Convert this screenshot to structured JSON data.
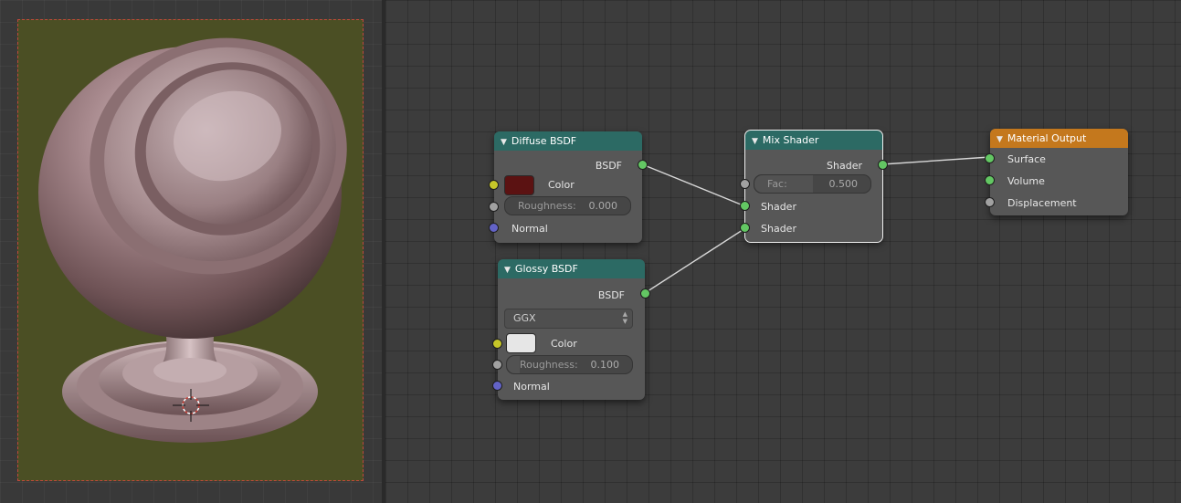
{
  "nodes": {
    "diffuse": {
      "title": "Diffuse BSDF",
      "output": "BSDF",
      "color_label": "Color",
      "color_value": "#5b1212",
      "roughness_label": "Roughness:",
      "roughness_value": "0.000",
      "normal_label": "Normal"
    },
    "glossy": {
      "title": "Glossy BSDF",
      "output": "BSDF",
      "distribution": "GGX",
      "color_label": "Color",
      "color_value": "#e6e6e6",
      "roughness_label": "Roughness:",
      "roughness_value": "0.100",
      "normal_label": "Normal"
    },
    "mix": {
      "title": "Mix Shader",
      "output": "Shader",
      "fac_label": "Fac:",
      "fac_value": "0.500",
      "input1": "Shader",
      "input2": "Shader"
    },
    "output": {
      "title": "Material Output",
      "surface": "Surface",
      "volume": "Volume",
      "displacement": "Displacement"
    }
  },
  "colors": {
    "shader_header": "#2c6a64",
    "output_header": "#c4781d",
    "shader_socket": "#63c763",
    "color_socket": "#c7c729",
    "value_socket": "#a1a1a1",
    "vector_socket": "#6363c7",
    "render_background": "#4b4f24"
  },
  "icons": {
    "collapse": "triangle-down-icon",
    "crosshair": "3d-cursor-icon"
  }
}
